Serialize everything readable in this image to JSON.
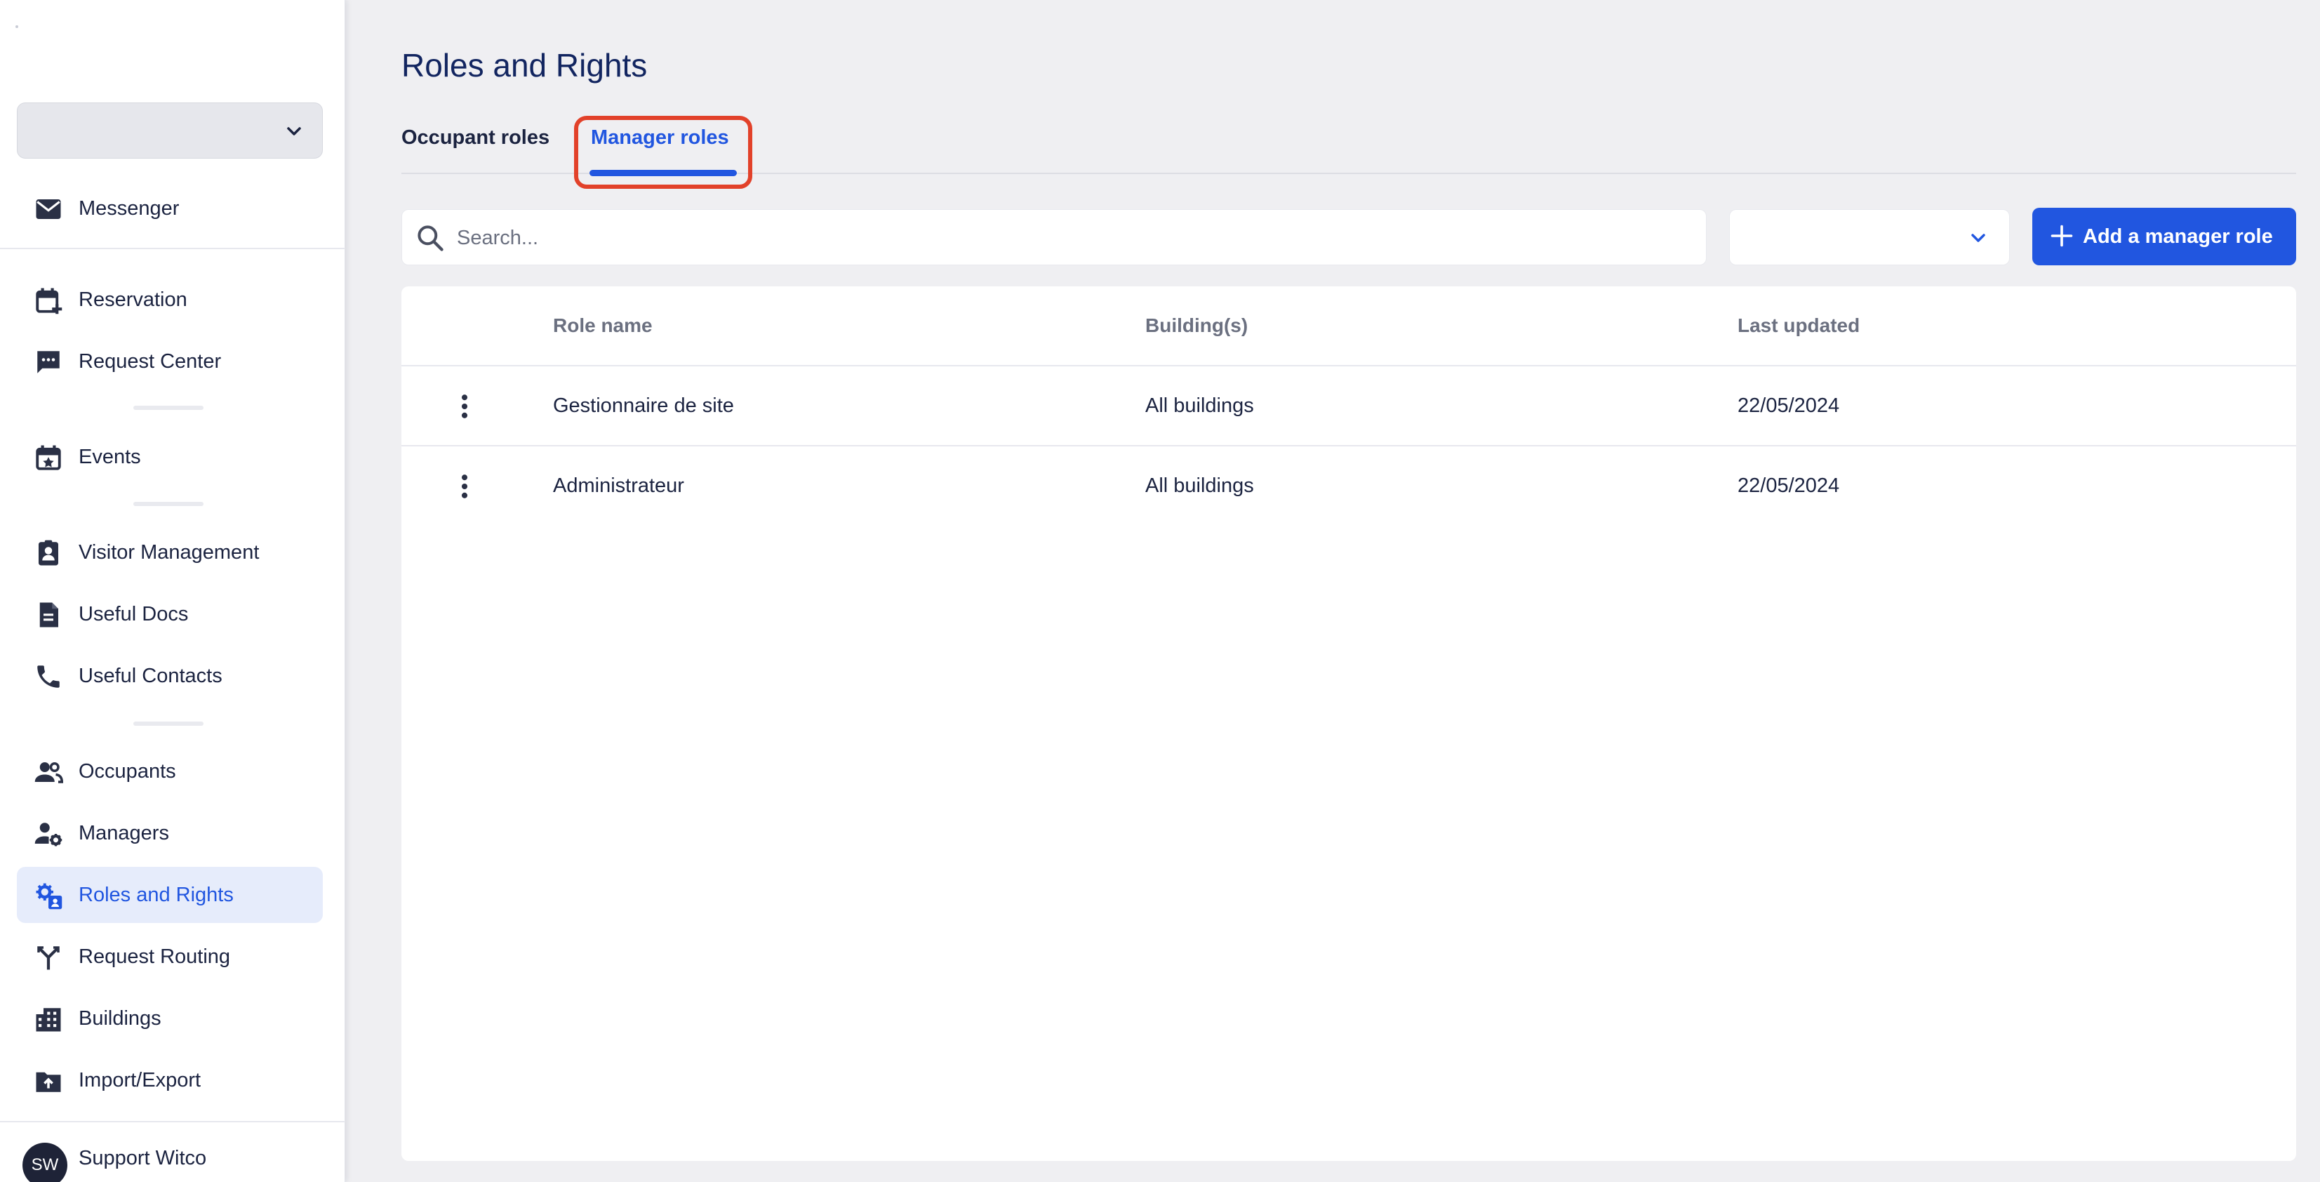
{
  "sidebar": {
    "site_selector": {
      "value": ""
    },
    "items": [
      {
        "label": "Messenger",
        "icon": "mail-icon"
      },
      {
        "label": "Reservation",
        "icon": "calendar-plus-icon"
      },
      {
        "label": "Request Center",
        "icon": "chat-icon"
      },
      {
        "label": "Events",
        "icon": "calendar-star-icon"
      },
      {
        "label": "Visitor Management",
        "icon": "badge-icon"
      },
      {
        "label": "Useful Docs",
        "icon": "document-icon"
      },
      {
        "label": "Useful Contacts",
        "icon": "phone-icon"
      },
      {
        "label": "Occupants",
        "icon": "people-icon"
      },
      {
        "label": "Managers",
        "icon": "user-gear-icon"
      },
      {
        "label": "Roles and Rights",
        "icon": "roles-gear-icon"
      },
      {
        "label": "Request Routing",
        "icon": "routing-icon"
      },
      {
        "label": "Buildings",
        "icon": "building-icon"
      },
      {
        "label": "Import/Export",
        "icon": "folder-upload-icon"
      }
    ],
    "active_item": "Roles and Rights",
    "user": {
      "initials": "SW",
      "name": "Support Witco"
    }
  },
  "main": {
    "title": "Roles and Rights",
    "tabs": [
      {
        "label": "Occupant roles",
        "active": false
      },
      {
        "label": "Manager roles",
        "active": true
      }
    ],
    "search": {
      "placeholder": "Search...",
      "value": ""
    },
    "filter": {
      "value": ""
    },
    "add_button_label": "Add a manager role",
    "table": {
      "columns": [
        "Role name",
        "Building(s)",
        "Last updated"
      ],
      "rows": [
        {
          "role_name": "Gestionnaire de site",
          "buildings": "All buildings",
          "last_updated": "22/05/2024"
        },
        {
          "role_name": "Administrateur",
          "buildings": "All buildings",
          "last_updated": "22/05/2024"
        }
      ]
    }
  },
  "colors": {
    "accent": "#2156e0",
    "highlight_outline": "#e2412a",
    "page_background": "#efeff2",
    "active_nav_background": "#e6ecfb",
    "title": "#122560"
  }
}
